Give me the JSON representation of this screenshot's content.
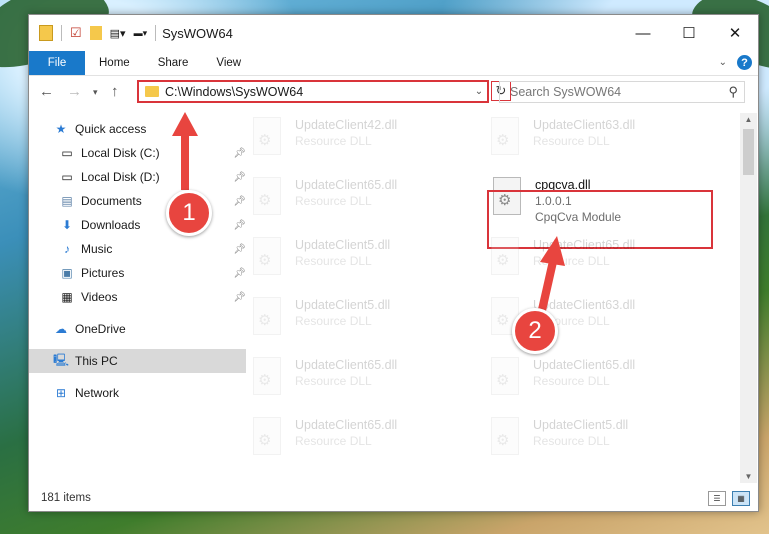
{
  "window": {
    "title": "SysWOW64"
  },
  "ribbon": {
    "tabs": [
      "File",
      "Home",
      "Share",
      "View"
    ]
  },
  "address": {
    "path": "C:\\Windows\\SysWOW64"
  },
  "search": {
    "placeholder": "Search SysWOW64"
  },
  "navpane": {
    "items": [
      {
        "label": "Quick access",
        "icon": "star-icon",
        "pinned": false
      },
      {
        "label": "Local Disk (C:)",
        "icon": "drive-icon",
        "pinned": true
      },
      {
        "label": "Local Disk (D:)",
        "icon": "drive-icon",
        "pinned": true
      },
      {
        "label": "Documents",
        "icon": "documents-icon",
        "pinned": true
      },
      {
        "label": "Downloads",
        "icon": "download-icon",
        "pinned": true
      },
      {
        "label": "Music",
        "icon": "music-icon",
        "pinned": true
      },
      {
        "label": "Pictures",
        "icon": "pictures-icon",
        "pinned": true
      },
      {
        "label": "Videos",
        "icon": "videos-icon",
        "pinned": true
      },
      {
        "label": "OneDrive",
        "icon": "cloud-icon",
        "pinned": false
      },
      {
        "label": "This PC",
        "icon": "pc-icon",
        "pinned": false
      },
      {
        "label": "Network",
        "icon": "network-icon",
        "pinned": false
      }
    ]
  },
  "files": {
    "left": [
      {
        "name": "UpdateClient42.dll",
        "type": "Resource DLL"
      },
      {
        "name": "UpdateClient65.dll",
        "type": "Resource DLL"
      },
      {
        "name": "UpdateClient5.dll",
        "type": "Resource DLL"
      },
      {
        "name": "UpdateClient5.dll",
        "type": "Resource DLL"
      },
      {
        "name": "UpdateClient65.dll",
        "type": "Resource DLL"
      },
      {
        "name": "UpdateClient65.dll",
        "type": "Resource DLL"
      }
    ],
    "right": [
      {
        "name": "UpdateClient63.dll",
        "type": "Resource DLL"
      },
      {
        "name": "UpdateClient65.dll",
        "type": "Resource DLL"
      },
      {
        "name": "UpdateClient63.dll",
        "type": "Resource DLL"
      },
      {
        "name": "UpdateClient65.dll",
        "type": "Resource DLL"
      },
      {
        "name": "UpdateClient5.dll",
        "type": "Resource DLL"
      }
    ],
    "highlighted": {
      "name": "cpqcva.dll",
      "version": "1.0.0.1",
      "description": "CpqCva Module"
    }
  },
  "status": {
    "item_count": "181 items"
  },
  "annotations": {
    "step1": "1",
    "step2": "2",
    "color": "#e8453f"
  }
}
